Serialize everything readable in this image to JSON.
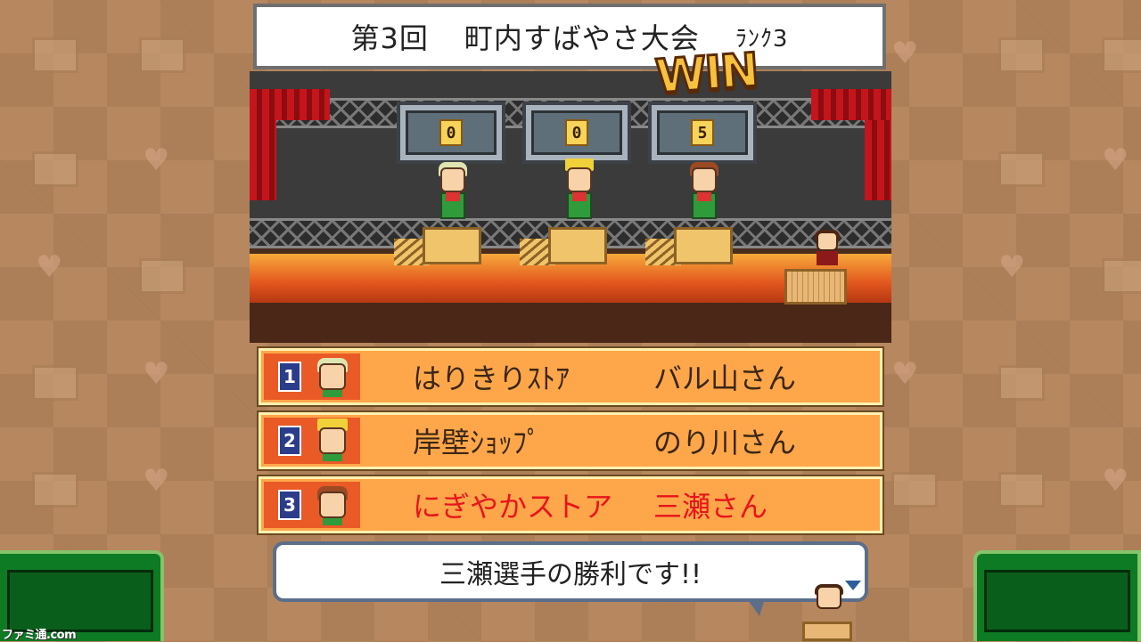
{
  "title": {
    "round": "第3回",
    "event": "町内すばやさ大会",
    "rank": "ﾗﾝｸ3"
  },
  "stage": {
    "win_label": "WIN",
    "scores": [
      "0",
      "0",
      "5"
    ]
  },
  "ranking": [
    {
      "place": "1",
      "shop": "はりきりｽﾄｱ",
      "person": "バル山さん"
    },
    {
      "place": "2",
      "shop": "岸壁ｼｮｯﾌﾟ",
      "person": "のり川さん"
    },
    {
      "place": "3",
      "shop": "にぎやかストア",
      "person": "三瀬さん"
    }
  ],
  "dialog": {
    "message": "三瀬選手の勝利です!!"
  },
  "watermark": "ファミ通.com",
  "colors": {
    "rank_row": "#fda74a",
    "highlight_text": "#e8141c",
    "win_gold": "#f6c13c",
    "panel_green": "#0d7a24"
  }
}
